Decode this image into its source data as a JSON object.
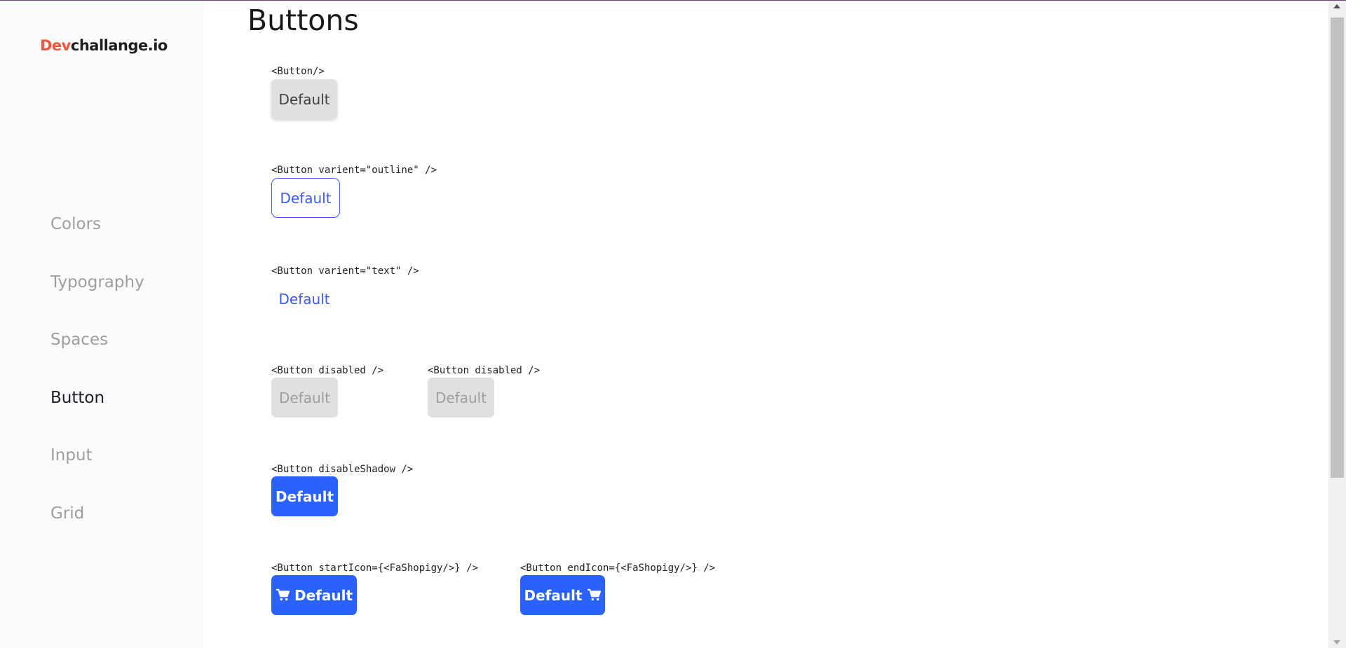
{
  "logo": {
    "accent": "Dev",
    "rest": "challange.io"
  },
  "sidebar": {
    "items": [
      {
        "label": "Colors",
        "active": false
      },
      {
        "label": "Typography",
        "active": false
      },
      {
        "label": "Spaces",
        "active": false
      },
      {
        "label": "Button",
        "active": true
      },
      {
        "label": "Input",
        "active": false
      },
      {
        "label": "Grid",
        "active": false
      }
    ]
  },
  "main": {
    "title": "Buttons",
    "sections": [
      {
        "code": "<Button/>",
        "button_label": "Default",
        "variant": "default"
      },
      {
        "code": "<Button varient=\"outline\" />",
        "button_label": "Default",
        "variant": "outline"
      },
      {
        "code": "<Button varient=\"text\" />",
        "button_label": "Default",
        "variant": "text"
      },
      {
        "code": "<Button disabled />",
        "button_label": "Default",
        "variant": "disabled"
      },
      {
        "code": "<Button disabled />",
        "button_label": "Default",
        "variant": "disabled"
      },
      {
        "code": "<Button disableShadow />",
        "button_label": "Default",
        "variant": "primary"
      },
      {
        "code": "<Button startIcon={<FaShopigy/>} />",
        "button_label": "Default",
        "variant": "primary",
        "icon": "cart-icon"
      },
      {
        "code": "<Button endIcon={<FaShopigy/>} />",
        "button_label": "Default",
        "variant": "primary",
        "icon": "cart-icon"
      }
    ]
  },
  "colors": {
    "brand_accent": "#f2573b",
    "primary": "#2962ff",
    "outline": "#3d5afe",
    "disabled_bg": "#e0e0e0",
    "disabled_text": "#9e9e9e",
    "nav_inactive": "#9e9e9e",
    "nav_active": "#1e1e23"
  }
}
